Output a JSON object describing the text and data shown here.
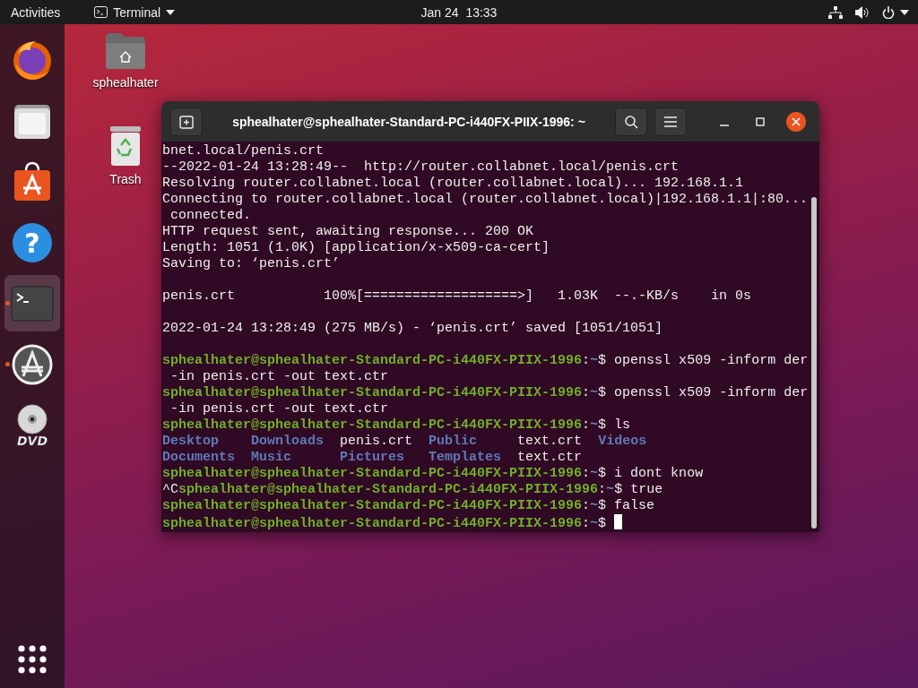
{
  "top_bar": {
    "activities": "Activities",
    "app_menu": "Terminal",
    "clock": "Jan 24  13:33"
  },
  "dock": {
    "items": [
      {
        "kind": "browser",
        "selected": false,
        "running": false
      },
      {
        "kind": "files",
        "selected": false,
        "running": false
      },
      {
        "kind": "software",
        "selected": false,
        "running": false
      },
      {
        "kind": "help",
        "glyph": "?",
        "selected": false,
        "running": false
      },
      {
        "kind": "terminal",
        "selected": true,
        "running": true
      },
      {
        "kind": "updater",
        "selected": false,
        "running": true
      },
      {
        "kind": "dvd",
        "glyph": "DVD",
        "selected": false,
        "running": false
      }
    ]
  },
  "desktop_icons": [
    {
      "kind": "home",
      "label": "sphealhater"
    },
    {
      "kind": "trash",
      "label": "Trash"
    }
  ],
  "terminal": {
    "title": "sphealhater@sphealhater-Standard-PC-i440FX-PIIX-1996: ~",
    "cursor_visible": true,
    "lines": [
      {
        "kind": "output",
        "segments": [
          {
            "kind": "plain",
            "text": "bnet.local/penis.crt"
          }
        ]
      },
      {
        "kind": "output",
        "segments": [
          {
            "kind": "plain",
            "text": "--2022-01-24 13:28:49--  http://router.collabnet.local/penis.crt"
          }
        ]
      },
      {
        "kind": "output",
        "segments": [
          {
            "kind": "plain",
            "text": "Resolving router.collabnet.local (router.collabnet.local)... 192.168.1.1"
          }
        ]
      },
      {
        "kind": "output",
        "segments": [
          {
            "kind": "plain",
            "text": "Connecting to router.collabnet.local (router.collabnet.local)|192.168.1.1|:80..."
          }
        ]
      },
      {
        "kind": "output",
        "segments": [
          {
            "kind": "plain",
            "text": " connected."
          }
        ]
      },
      {
        "kind": "output",
        "segments": [
          {
            "kind": "plain",
            "text": "HTTP request sent, awaiting response... 200 OK"
          }
        ]
      },
      {
        "kind": "output",
        "segments": [
          {
            "kind": "plain",
            "text": "Length: 1051 (1.0K) [application/x-x509-ca-cert]"
          }
        ]
      },
      {
        "kind": "output",
        "segments": [
          {
            "kind": "plain",
            "text": "Saving to: ‘penis.crt’"
          }
        ]
      },
      {
        "kind": "blank"
      },
      {
        "kind": "output",
        "segments": [
          {
            "kind": "plain",
            "text": "penis.crt           100%[===================>]   1.03K  --.-KB/s    in 0s"
          }
        ]
      },
      {
        "kind": "blank"
      },
      {
        "kind": "output",
        "segments": [
          {
            "kind": "plain",
            "text": "2022-01-24 13:28:49 (275 MB/s) - ‘penis.crt’ saved [1051/1051]"
          }
        ]
      },
      {
        "kind": "blank"
      },
      {
        "kind": "output",
        "segments": [
          {
            "kind": "prompt",
            "text": "sphealhater@sphealhater-Standard-PC-i440FX-PIIX-1996"
          },
          {
            "kind": "plain",
            "text": ":"
          },
          {
            "kind": "path",
            "text": "~"
          },
          {
            "kind": "plain",
            "text": "$ openssl x509 -inform der"
          }
        ]
      },
      {
        "kind": "output",
        "segments": [
          {
            "kind": "plain",
            "text": " -in penis.crt -out text.ctr"
          }
        ]
      },
      {
        "kind": "output",
        "segments": [
          {
            "kind": "prompt",
            "text": "sphealhater@sphealhater-Standard-PC-i440FX-PIIX-1996"
          },
          {
            "kind": "plain",
            "text": ":"
          },
          {
            "kind": "path",
            "text": "~"
          },
          {
            "kind": "plain",
            "text": "$ openssl x509 -inform der"
          }
        ]
      },
      {
        "kind": "output",
        "segments": [
          {
            "kind": "plain",
            "text": " -in penis.crt -out text.ctr"
          }
        ]
      },
      {
        "kind": "output",
        "segments": [
          {
            "kind": "prompt",
            "text": "sphealhater@sphealhater-Standard-PC-i440FX-PIIX-1996"
          },
          {
            "kind": "plain",
            "text": ":"
          },
          {
            "kind": "path",
            "text": "~"
          },
          {
            "kind": "plain",
            "text": "$ ls"
          }
        ]
      },
      {
        "kind": "output",
        "segments": [
          {
            "kind": "dir",
            "text": "Desktop    "
          },
          {
            "kind": "dir",
            "text": "Downloads"
          },
          {
            "kind": "plain",
            "text": "  penis.crt  "
          },
          {
            "kind": "dir",
            "text": "Public"
          },
          {
            "kind": "plain",
            "text": "     text.crt  "
          },
          {
            "kind": "dir",
            "text": "Videos"
          }
        ]
      },
      {
        "kind": "output",
        "segments": [
          {
            "kind": "dir",
            "text": "Documents  "
          },
          {
            "kind": "dir",
            "text": "Music      "
          },
          {
            "kind": "dir",
            "text": "Pictures   "
          },
          {
            "kind": "dir",
            "text": "Templates"
          },
          {
            "kind": "plain",
            "text": "  text.ctr"
          }
        ]
      },
      {
        "kind": "output",
        "segments": [
          {
            "kind": "prompt",
            "text": "sphealhater@sphealhater-Standard-PC-i440FX-PIIX-1996"
          },
          {
            "kind": "plain",
            "text": ":"
          },
          {
            "kind": "path",
            "text": "~"
          },
          {
            "kind": "plain",
            "text": "$ i dont know"
          }
        ]
      },
      {
        "kind": "output",
        "segments": [
          {
            "kind": "plain",
            "text": "^C"
          },
          {
            "kind": "prompt",
            "text": "sphealhater@sphealhater-Standard-PC-i440FX-PIIX-1996"
          },
          {
            "kind": "plain",
            "text": ":"
          },
          {
            "kind": "path",
            "text": "~"
          },
          {
            "kind": "plain",
            "text": "$ true"
          }
        ]
      },
      {
        "kind": "output",
        "segments": [
          {
            "kind": "prompt",
            "text": "sphealhater@sphealhater-Standard-PC-i440FX-PIIX-1996"
          },
          {
            "kind": "plain",
            "text": ":"
          },
          {
            "kind": "path",
            "text": "~"
          },
          {
            "kind": "plain",
            "text": "$ false"
          }
        ]
      },
      {
        "kind": "output",
        "segments": [
          {
            "kind": "prompt",
            "text": "sphealhater@sphealhater-Standard-PC-i440FX-PIIX-1996"
          },
          {
            "kind": "plain",
            "text": ":"
          },
          {
            "kind": "path",
            "text": "~"
          },
          {
            "kind": "plain",
            "text": "$ "
          }
        ]
      }
    ]
  }
}
